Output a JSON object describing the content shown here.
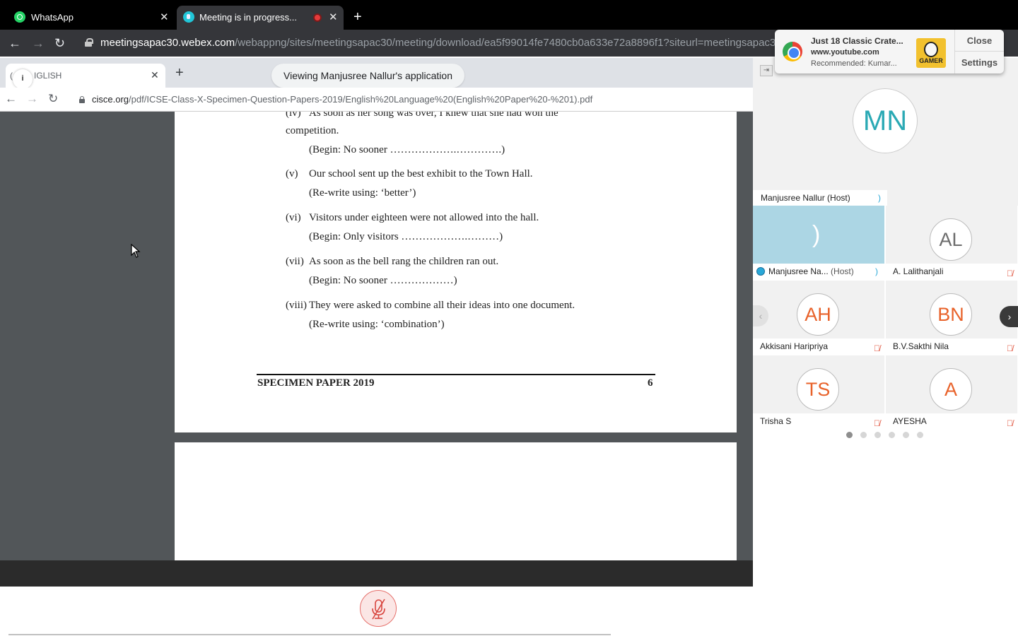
{
  "browser": {
    "tabs": [
      {
        "title": "WhatsApp"
      },
      {
        "title": "Meeting is in progress..."
      }
    ],
    "url": {
      "host": "meetingsapac30.webex.com",
      "path": "/webappng/sites/meetingsapac30/meeting/download/ea5f99014fe7480cb0a633e72a8896f1?siteurl=meetingsapac30"
    }
  },
  "notification": {
    "title": "Just 18 Classic Crate...",
    "site": "www.youtube.com",
    "body": "Recommended: Kumar...",
    "thumb_label": "GAMER",
    "close_label": "Close",
    "settings_label": "Settings"
  },
  "shared": {
    "viewing_label": "Viewing Manjusree Nallur's application",
    "inner_tab": {
      "prefix": "(",
      "title": "IGLISH"
    },
    "url": {
      "host": "cisce.org",
      "path": "/pdf/ICSE-Class-X-Specimen-Question-Papers-2019/English%20Language%20(English%20Paper%20-%201).pdf"
    },
    "pdf": {
      "lines": [
        {
          "num": "(iv)",
          "text": "As soon as her song was over, I knew that she had won the"
        },
        {
          "num": "",
          "text": "competition."
        },
        {
          "num": "",
          "text": "(Begin: No sooner ……………….………….)"
        },
        {
          "num": "(v)",
          "text": "Our school sent up the best exhibit to the Town Hall."
        },
        {
          "num": "",
          "text": "(Re-write using: ‘better’)"
        },
        {
          "num": "(vi)",
          "text": "Visitors under eighteen were not allowed into the hall."
        },
        {
          "num": "",
          "text": "(Begin: Only visitors ……………….………)"
        },
        {
          "num": "(vii)",
          "text": "As soon as the bell rang the children ran out."
        },
        {
          "num": "",
          "text": "(Begin: No sooner ………………)"
        },
        {
          "num": "(viii)",
          "text": "They were asked to combine all their ideas into one document."
        },
        {
          "num": "",
          "text": "(Re-write using: ‘combination’)"
        }
      ],
      "footer_title": "SPECIMEN PAPER 2019",
      "footer_page": "6"
    }
  },
  "panel": {
    "active_speaker": {
      "initials": "MN",
      "name": "Manjusree Nallur (Host)"
    },
    "participants": [
      {
        "initials": "",
        "name": "Manjusree Na...",
        "role": "(Host)",
        "muted": false,
        "video": true
      },
      {
        "initials": "AL",
        "name": "A. Lalithanjali",
        "muted": true
      },
      {
        "initials": "AH",
        "name": "Akkisani Haripriya",
        "muted": true
      },
      {
        "initials": "BN",
        "name": "B.V.Sakthi Nila",
        "muted": true
      },
      {
        "initials": "TS",
        "name": "Trisha S",
        "muted": true
      },
      {
        "initials": "A",
        "name": "AYESHA",
        "muted": true
      }
    ],
    "pages": 6,
    "current_page": 1
  }
}
